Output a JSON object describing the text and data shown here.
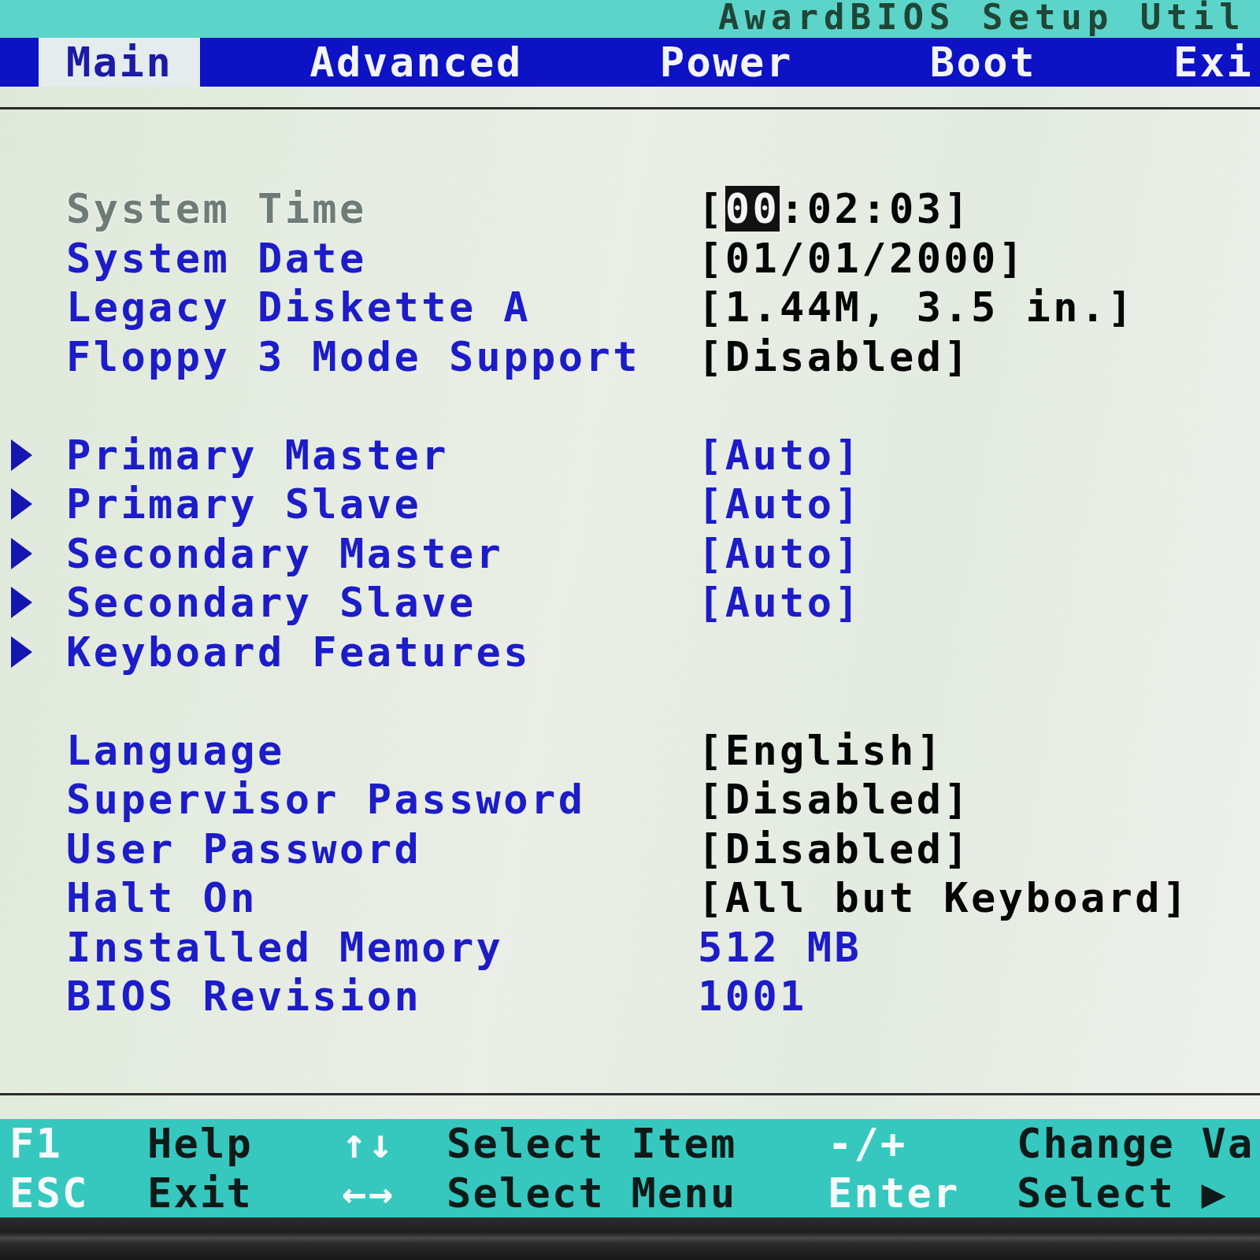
{
  "title": "AwardBIOS Setup Util",
  "tabs": [
    {
      "label": "Main",
      "selected": true
    },
    {
      "label": "Advanced",
      "selected": false
    },
    {
      "label": "Power",
      "selected": false
    },
    {
      "label": "Boot",
      "selected": false
    },
    {
      "label": "Exi",
      "selected": false
    }
  ],
  "groups": [
    {
      "rows": [
        {
          "kind": "setting",
          "label": "System Time",
          "selected": true,
          "read_only": false,
          "value_parts": [
            {
              "text": "[",
              "selected": false
            },
            {
              "text": "00",
              "selected": true
            },
            {
              "text": ":02:03]",
              "selected": false
            }
          ]
        },
        {
          "kind": "setting",
          "label": "System Date",
          "selected": false,
          "read_only": false,
          "value": "[01/01/2000]"
        },
        {
          "kind": "setting",
          "label": "Legacy Diskette A",
          "selected": false,
          "read_only": false,
          "value": "[1.44M, 3.5 in.]"
        },
        {
          "kind": "setting",
          "label": "Floppy 3 Mode Support",
          "selected": false,
          "read_only": false,
          "value": "[Disabled]"
        }
      ]
    },
    {
      "rows": [
        {
          "kind": "submenu",
          "label": "Primary Master",
          "selected": false,
          "read_only": true,
          "value": "[Auto]"
        },
        {
          "kind": "submenu",
          "label": "Primary Slave",
          "selected": false,
          "read_only": true,
          "value": "[Auto]"
        },
        {
          "kind": "submenu",
          "label": "Secondary Master",
          "selected": false,
          "read_only": true,
          "value": "[Auto]"
        },
        {
          "kind": "submenu",
          "label": "Secondary Slave",
          "selected": false,
          "read_only": true,
          "value": "[Auto]"
        },
        {
          "kind": "submenu",
          "label": "Keyboard Features",
          "selected": false
        }
      ]
    },
    {
      "rows": [
        {
          "kind": "setting",
          "label": "Language",
          "selected": false,
          "read_only": false,
          "value": "[English]"
        },
        {
          "kind": "setting",
          "label": "Supervisor Password",
          "selected": false,
          "read_only": false,
          "value": "[Disabled]"
        },
        {
          "kind": "setting",
          "label": "User Password",
          "selected": false,
          "read_only": false,
          "value": "[Disabled]"
        },
        {
          "kind": "setting",
          "label": "Halt On",
          "selected": false,
          "read_only": false,
          "value": "[All but Keyboard]"
        },
        {
          "kind": "setting",
          "label": "Installed Memory",
          "selected": false,
          "read_only": true,
          "value": "512 MB"
        },
        {
          "kind": "setting",
          "label": "BIOS Revision",
          "selected": false,
          "read_only": true,
          "value": "1001"
        }
      ]
    }
  ],
  "key_help": [
    [
      {
        "key": "F1",
        "action": "Help"
      },
      {
        "key": "↑↓",
        "action": "Select Item"
      },
      {
        "key": "-/+",
        "action": "Change Va"
      }
    ],
    [
      {
        "key": "ESC",
        "action": "Exit"
      },
      {
        "key": "←→",
        "action": "Select Menu"
      },
      {
        "key": "Enter",
        "action": "Select ▶"
      }
    ]
  ]
}
